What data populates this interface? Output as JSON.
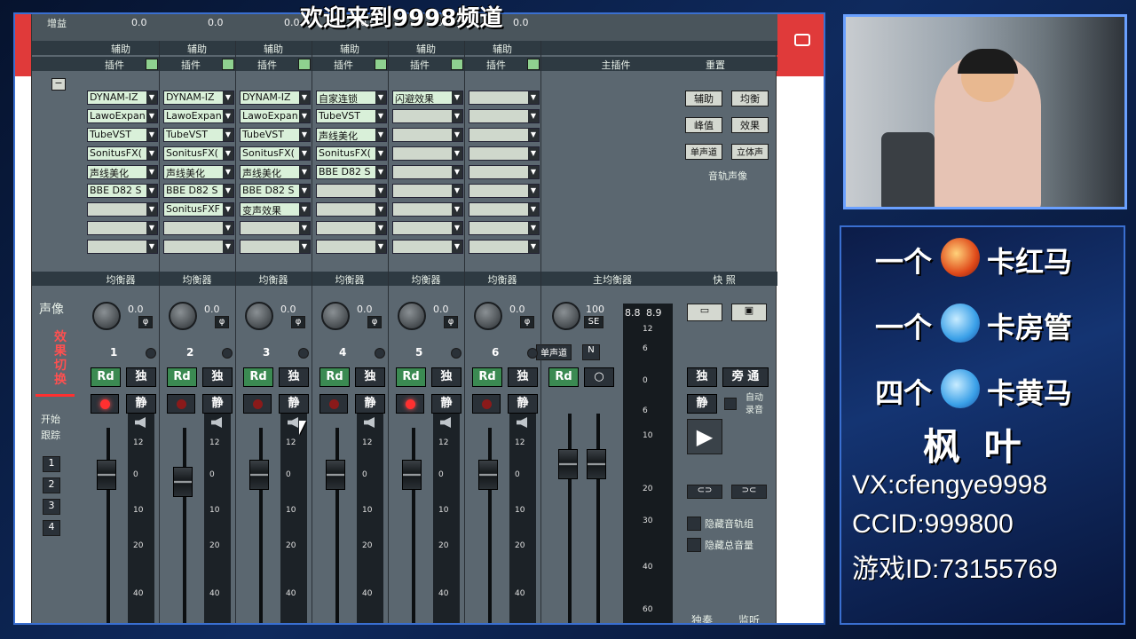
{
  "banner": "欢迎来到9998频道",
  "top_labels": {
    "gain": "增益",
    "aux": "辅助",
    "insert": "插件",
    "main_insert": "主插件",
    "reset": "重置",
    "gain_val": "0.0"
  },
  "channels": [
    {
      "num": "1",
      "plugins": [
        "DYNAM-IZ",
        "LawoExpan",
        "TubeVST",
        "SonitusFX(",
        "声线美化",
        "BBE D82 S",
        "",
        "",
        ""
      ],
      "pan": "0.0",
      "led_on": true
    },
    {
      "num": "2",
      "plugins": [
        "DYNAM-IZ",
        "LawoExpan",
        "TubeVST",
        "SonitusFX(",
        "声线美化",
        "BBE D82 S",
        "SonitusFXF",
        "",
        ""
      ],
      "pan": "0.0",
      "led_on": false
    },
    {
      "num": "3",
      "plugins": [
        "DYNAM-IZ",
        "LawoExpan",
        "TubeVST",
        "SonitusFX(",
        "声线美化",
        "BBE D82 S",
        "变声效果",
        "",
        ""
      ],
      "pan": "0.0",
      "led_on": false
    },
    {
      "num": "4",
      "plugins": [
        "自家连锁",
        "TubeVST",
        "声线美化",
        "SonitusFX(",
        "BBE D82 S",
        "",
        "",
        "",
        ""
      ],
      "pan": "0.0",
      "led_on": false
    },
    {
      "num": "5",
      "plugins": [
        "闪避效果",
        "",
        "",
        "",
        "",
        "",
        "",
        "",
        ""
      ],
      "pan": "0.0",
      "led_on": true
    },
    {
      "num": "6",
      "plugins": [
        "",
        "",
        "",
        "",
        "",
        "",
        "",
        "",
        ""
      ],
      "pan": "0.0",
      "led_on": false
    }
  ],
  "eq_label": "均衡器",
  "main_eq_label": "主均衡器",
  "quick_label": "快 照",
  "master": {
    "pan": "100",
    "se": "SE",
    "mono": "单声道",
    "n": "N",
    "peak_l": "8.8",
    "peak_r": "8.9"
  },
  "right_buttons": {
    "aux": "辅助",
    "eq": "均衡",
    "peak": "峰值",
    "effect": "效果",
    "mono": "单声道",
    "stereo": "立体声",
    "track_image": "音轨声像",
    "solo": "独",
    "bypass": "旁 通",
    "mute": "静",
    "auto_record": "自动录音",
    "hide_track_group": "隐藏音轨组",
    "hide_master_vol": "隐藏总音量",
    "solo_play": "独奏",
    "monitor": "监听"
  },
  "left_labels": {
    "pan": "声像",
    "effect_switch": "效果切换",
    "start_follow": "开始跟踪",
    "nums": [
      "1",
      "2",
      "3",
      "4"
    ]
  },
  "btn_labels": {
    "rd": "Rd",
    "solo": "独",
    "mute": "静",
    "phi": "φ"
  },
  "scale_ticks": [
    "12",
    "0",
    "10",
    "20",
    "40"
  ],
  "master_scale": [
    "12",
    "6",
    "0",
    "6",
    "10",
    "20",
    "30",
    "40",
    "60"
  ],
  "promo": [
    {
      "left": "一个",
      "right": "卡红马"
    },
    {
      "left": "一个",
      "right": "卡房管"
    },
    {
      "left": "四个",
      "right": "卡黄马"
    }
  ],
  "streamer": "枫 叶",
  "info_lines": [
    "VX:cfengye9998",
    "CCID:999800",
    "游戏ID:73155769"
  ]
}
